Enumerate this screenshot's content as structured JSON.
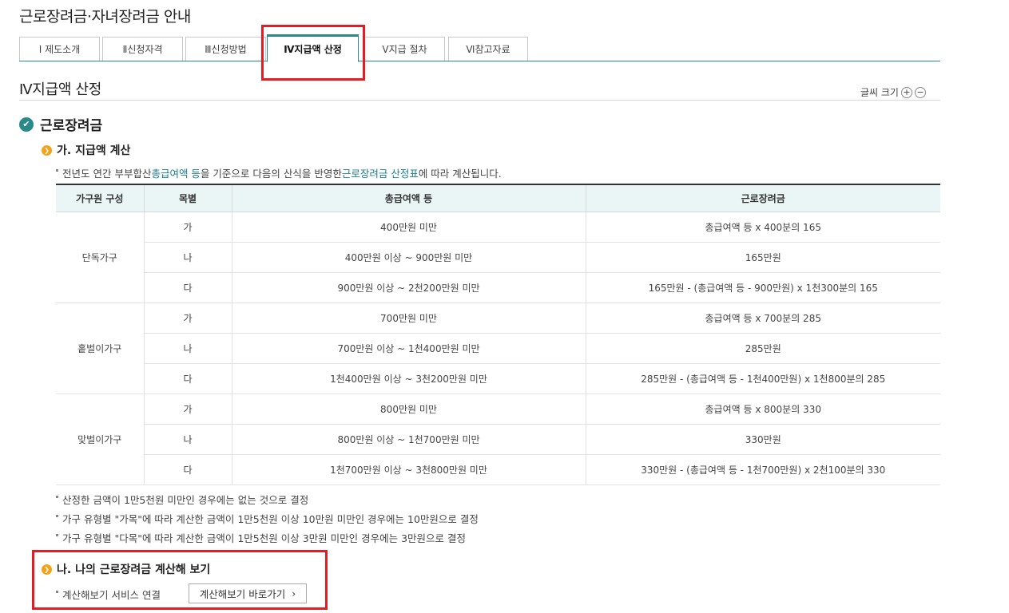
{
  "page_title": "근로장려금·자녀장려금 안내",
  "tabs": [
    {
      "label": "Ⅰ 제도소개"
    },
    {
      "label": "Ⅱ신청자격"
    },
    {
      "label": "Ⅲ신청방법"
    },
    {
      "label": "Ⅳ지급액 산정"
    },
    {
      "label": "Ⅴ지급 절차"
    },
    {
      "label": "Ⅵ참고자료"
    }
  ],
  "section_title": "Ⅳ지급액 산정",
  "font_size_label": "글씨 크기",
  "heading": "근로장려금",
  "sub_a": {
    "title": "가. 지급액 계산",
    "intro_pre": "전년도 연간 부부합산 ",
    "intro_link1": "총급여액 등",
    "intro_mid": "을 기준으로 다음의 산식을 반영한 ",
    "intro_link2": "근로장려금 산정표",
    "intro_post": "에 따라 계산됩니다."
  },
  "table": {
    "headers": [
      "가구원 구성",
      "목별",
      "총급여액 등",
      "근로장려금"
    ],
    "groups": [
      {
        "name": "단독가구",
        "rows": [
          {
            "grade": "가",
            "income": "400만원 미만",
            "amount": "총급여액 등 x 400분의 165"
          },
          {
            "grade": "나",
            "income": "400만원 이상 ~ 900만원 미만",
            "amount": "165만원"
          },
          {
            "grade": "다",
            "income": "900만원 이상 ~ 2천200만원 미만",
            "amount": "165만원 - (총급여액 등 - 900만원) x 1천300분의 165"
          }
        ]
      },
      {
        "name": "홑벌이가구",
        "rows": [
          {
            "grade": "가",
            "income": "700만원 미만",
            "amount": "총급여액 등 x 700분의 285"
          },
          {
            "grade": "나",
            "income": "700만원 이상 ~ 1천400만원 미만",
            "amount": "285만원"
          },
          {
            "grade": "다",
            "income": "1천400만원 이상 ~ 3천200만원 미만",
            "amount": "285만원 - (총급여액 등 - 1천400만원) x 1천800분의 285"
          }
        ]
      },
      {
        "name": "맞벌이가구",
        "rows": [
          {
            "grade": "가",
            "income": "800만원 미만",
            "amount": "총급여액 등 x 800분의 330"
          },
          {
            "grade": "나",
            "income": "800만원 이상 ~ 1천700만원 미만",
            "amount": "330만원"
          },
          {
            "grade": "다",
            "income": "1천700만원 이상 ~ 3천800만원 미만",
            "amount": "330만원 - (총급여액 등 - 1천700만원) x 2천100분의 330"
          }
        ]
      }
    ]
  },
  "notes": [
    "산정한 금액이 1만5천원 미만인 경우에는 없는 것으로 결정",
    "가구 유형별 \"가목\"에 따라 계산한 금액이 1만5천원 이상 10만원 미만인 경우에는 10만원으로 결정",
    "가구 유형별 \"다목\"에 따라 계산한 금액이 1만5천원 이상 3만원 미만인 경우에는 3만원으로 결정"
  ],
  "sub_b": {
    "title": "나. 나의 근로장려금 계산해 보기",
    "service_label": "계산해보기 서비스 연결",
    "button_label": "계산해보기 바로가기"
  }
}
